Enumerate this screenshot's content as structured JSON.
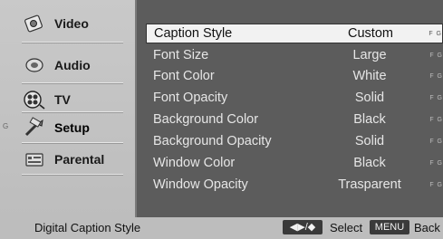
{
  "left_menu": {
    "items": [
      {
        "label": "Video",
        "icon": "video-icon"
      },
      {
        "label": "Audio",
        "icon": "audio-icon"
      },
      {
        "label": "TV",
        "icon": "tv-icon"
      },
      {
        "label": "Setup",
        "icon": "setup-icon",
        "marker": "G"
      },
      {
        "label": "Parental",
        "icon": "parental-icon"
      }
    ]
  },
  "settings": {
    "rows": [
      {
        "name": "Caption Style",
        "value": "Custom",
        "flag": "F G"
      },
      {
        "name": "Font Size",
        "value": "Large",
        "flag": "F G"
      },
      {
        "name": "Font Color",
        "value": "White",
        "flag": "F G"
      },
      {
        "name": "Font Opacity",
        "value": "Solid",
        "flag": "F G"
      },
      {
        "name": "Background Color",
        "value": "Black",
        "flag": "F G"
      },
      {
        "name": "Background Opacity",
        "value": "Solid",
        "flag": "F G"
      },
      {
        "name": "Window Color",
        "value": "Black",
        "flag": "F G"
      },
      {
        "name": "Window Opacity",
        "value": "Trasparent",
        "flag": "F G"
      }
    ]
  },
  "bottom_bar": {
    "title": "Digital Caption Style",
    "nav_key": "◀▶/◆",
    "select_label": "Select",
    "menu_key": "MENU",
    "back_label": "Back"
  }
}
